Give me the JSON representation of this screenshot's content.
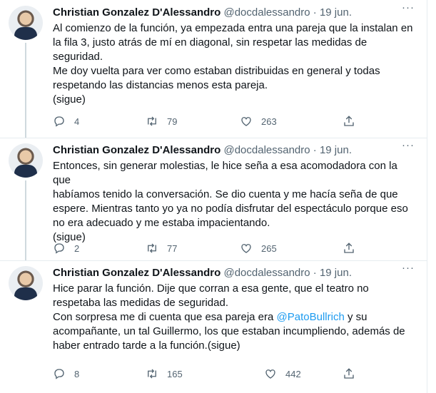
{
  "tweets": [
    {
      "name": "Christian Gonzalez D'Alessandro",
      "handle": "@docdalessandro",
      "dot": "·",
      "time": "19 jun.",
      "lines": [
        "Al comienzo de la función, ya empezada entra una pareja que la instalan en",
        "la fila 3, justo atrás de mí en diagonal, sin respetar las medidas de",
        "seguridad.",
        "Me doy vuelta para ver como estaban distribuidas en general y todas",
        "respetando las distancias menos esta pareja.",
        "(sigue)"
      ],
      "replies": "4",
      "retweets": "79",
      "likes": "263"
    },
    {
      "name": "Christian Gonzalez D'Alessandro",
      "handle": "@docdalessandro",
      "dot": "·",
      "time": "19 jun.",
      "lines": [
        "Entonces, sin generar molestias, le hice seña a esa acomodadora con la que",
        "habíamos tenido la conversación. Se dio cuenta y me hacía seña de que",
        "espere. Mientras tanto  yo ya no podía disfrutar del espectáculo porque eso",
        "no era adecuado y me estaba impacientando.",
        "(sigue)"
      ],
      "replies": "2",
      "retweets": "77",
      "likes": "265"
    },
    {
      "name": "Christian Gonzalez D'Alessandro",
      "handle": "@docdalessandro",
      "dot": "·",
      "time": "19 jun.",
      "lines": [
        "Hice parar la función. Dije que corran a esa gente, que el teatro no",
        "respetaba las medidas de seguridad."
      ],
      "line3_before": "Con sorpresa me di cuenta que esa pareja era ",
      "mention": "@PatoBullrich",
      "line3_after": " y su",
      "lines_after": [
        "acompañante, un tal Guillermo, los que estaban incumpliendo, además de",
        "haber entrado tarde a la función.(sigue)"
      ],
      "replies": "8",
      "retweets": "165",
      "likes": "442"
    }
  ],
  "icons": {
    "reply": "reply-icon",
    "retweet": "retweet-icon",
    "like": "heart-icon",
    "share": "share-icon",
    "more": "more-icon"
  },
  "colors": {
    "text": "#0f1419",
    "secondary": "#536471",
    "link": "#1d9bf0",
    "border": "#e6ecf0"
  }
}
